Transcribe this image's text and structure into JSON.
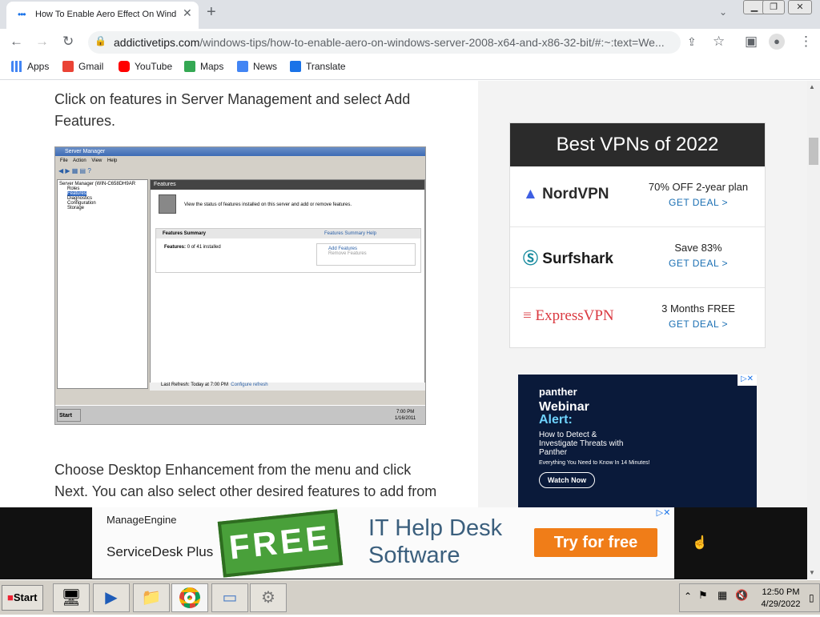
{
  "browser": {
    "tab_title": "How To Enable Aero Effect On Wind",
    "url_domain": "addictivetips.com",
    "url_path": "/windows-tips/how-to-enable-aero-on-windows-server-2008-x64-and-x86-32-bit/#:~:text=We...",
    "bookmarks": [
      "Apps",
      "Gmail",
      "YouTube",
      "Maps",
      "News",
      "Translate"
    ]
  },
  "article": {
    "para1": "Click on features in Server Management and select Add Features.",
    "para2": "Choose Desktop Enhancement from the menu and click Next. You can also select other desired features to add from",
    "screenshot": {
      "window_title": "Server Manager",
      "menu": [
        "File",
        "Action",
        "View",
        "Help"
      ],
      "tree": [
        "Server Manager (WIN-C658DH9AR",
        "Roles",
        "Features",
        "Diagnostics",
        "Configuration",
        "Storage"
      ],
      "header": "Features",
      "description": "View the status of features installed on this server and add or remove features.",
      "summary_title": "Features Summary",
      "summary_help": "Features Summary Help",
      "features_label": "Features:",
      "features_count": "0 of 41 installed",
      "add_features": "Add Features",
      "remove_features": "Remove Features",
      "last_refresh": "Last Refresh: Today at 7:00 PM",
      "configure_refresh": "Configure refresh",
      "start": "Start",
      "time": "7:00 PM",
      "date": "1/16/2011"
    }
  },
  "vpn_box": {
    "title": "Best VPNs of 2022",
    "items": [
      {
        "name": "NordVPN",
        "deal": "70% OFF 2-year plan",
        "cta": "GET DEAL >"
      },
      {
        "name": "Surfshark",
        "deal": "Save 83%",
        "cta": "GET DEAL >"
      },
      {
        "name": "ExpressVPN",
        "deal": "3 Months FREE",
        "cta": "GET DEAL >"
      }
    ]
  },
  "panther_ad": {
    "brand": "panther",
    "title1": "Webinar",
    "title2": "Alert:",
    "body": "How to Detect & Investigate Threats with Panther",
    "sub": "Everything You Need to Know In 14 Minutes!",
    "cta": "Watch Now"
  },
  "banner_ad": {
    "brand1": "ManageEngine",
    "brand2": "ServiceDesk Plus",
    "free": "FREE",
    "line1": "IT Help Desk",
    "line2": "Software",
    "cta": "Try for free"
  },
  "taskbar": {
    "start": "Start",
    "time": "12:50 PM",
    "date": "4/29/2022"
  }
}
